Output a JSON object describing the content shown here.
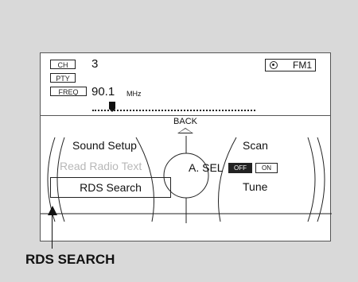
{
  "display": {
    "ch_label": "CH",
    "ch_value": "3",
    "pty_label": "PTY",
    "freq_label": "FREQ",
    "freq_value": "90.1",
    "freq_unit": "MHz",
    "band_label": "FM1",
    "back_label": "BACK"
  },
  "menu": {
    "sound_setup": "Sound Setup",
    "read_radio_text": "Read Radio Text",
    "rds_search": "RDS Search",
    "scan": "Scan",
    "a_sel": "A. SEL",
    "off": "OFF",
    "on": "ON",
    "tune": "Tune"
  },
  "caption": "RDS SEARCH"
}
